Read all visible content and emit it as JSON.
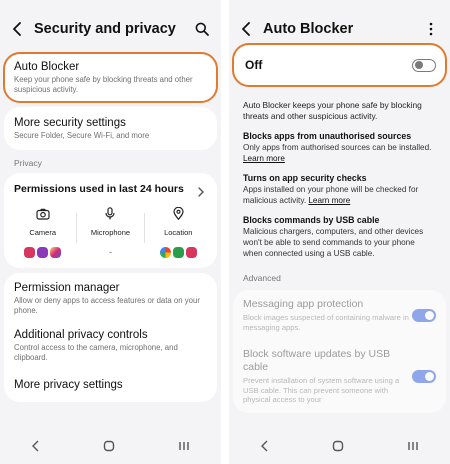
{
  "left": {
    "title": "Security and privacy",
    "auto_blocker": {
      "title": "Auto Blocker",
      "subtitle": "Keep your phone safe by blocking threats and other suspicious activity."
    },
    "more_security": {
      "title": "More security settings",
      "subtitle": "Secure Folder, Secure Wi-Fi, and more"
    },
    "privacy_label": "Privacy",
    "permissions": {
      "title": "Permissions used in last 24 hours",
      "columns": [
        {
          "label": "Camera",
          "icon": "camera-icon",
          "apps": [
            "#d8355f",
            "#e34a7f",
            "#c13584"
          ]
        },
        {
          "label": "Microphone",
          "icon": "microphone-icon",
          "apps": []
        },
        {
          "label": "Location",
          "icon": "location-pin-icon",
          "apps": [
            "#ea4335",
            "#2a9d4b",
            "#d8355f"
          ]
        }
      ],
      "empty_marker": "-"
    },
    "permission_manager": {
      "title": "Permission manager",
      "subtitle": "Allow or deny apps to access features or data on your phone."
    },
    "additional_privacy": {
      "title": "Additional privacy controls",
      "subtitle": "Control access to the camera, microphone, and clipboard."
    },
    "more_privacy": {
      "title": "More privacy settings"
    }
  },
  "right": {
    "title": "Auto Blocker",
    "toggle_label": "Off",
    "toggle_on": false,
    "description": "Auto Blocker keeps your phone safe by blocking threats and other suspicious activity.",
    "blocks": [
      {
        "title": "Blocks apps from unauthorised sources",
        "text": "Only apps from authorised sources can be installed.",
        "link": "Learn more"
      },
      {
        "title": "Turns on app security checks",
        "text": "Apps installed on your phone will be checked for malicious activity.",
        "link": "Learn more"
      },
      {
        "title": "Blocks commands by USB cable",
        "text": "Malicious chargers, computers, and other devices won't be able to send commands to your phone when connected using a USB cable.",
        "link": ""
      }
    ],
    "advanced_label": "Advanced",
    "advanced_items": [
      {
        "title": "Messaging app protection",
        "subtitle": "Block images suspected of containing malware in messaging apps.",
        "on": true
      },
      {
        "title": "Block software updates by USB cable",
        "subtitle": "Prevent installation of system software using a USB cable. This can prevent someone with physical access to your",
        "on": true
      }
    ]
  },
  "colors": {
    "highlight": "#e07a30",
    "toggle_off": "#8a8a8a",
    "toggle_on": "#3e6ae1"
  }
}
